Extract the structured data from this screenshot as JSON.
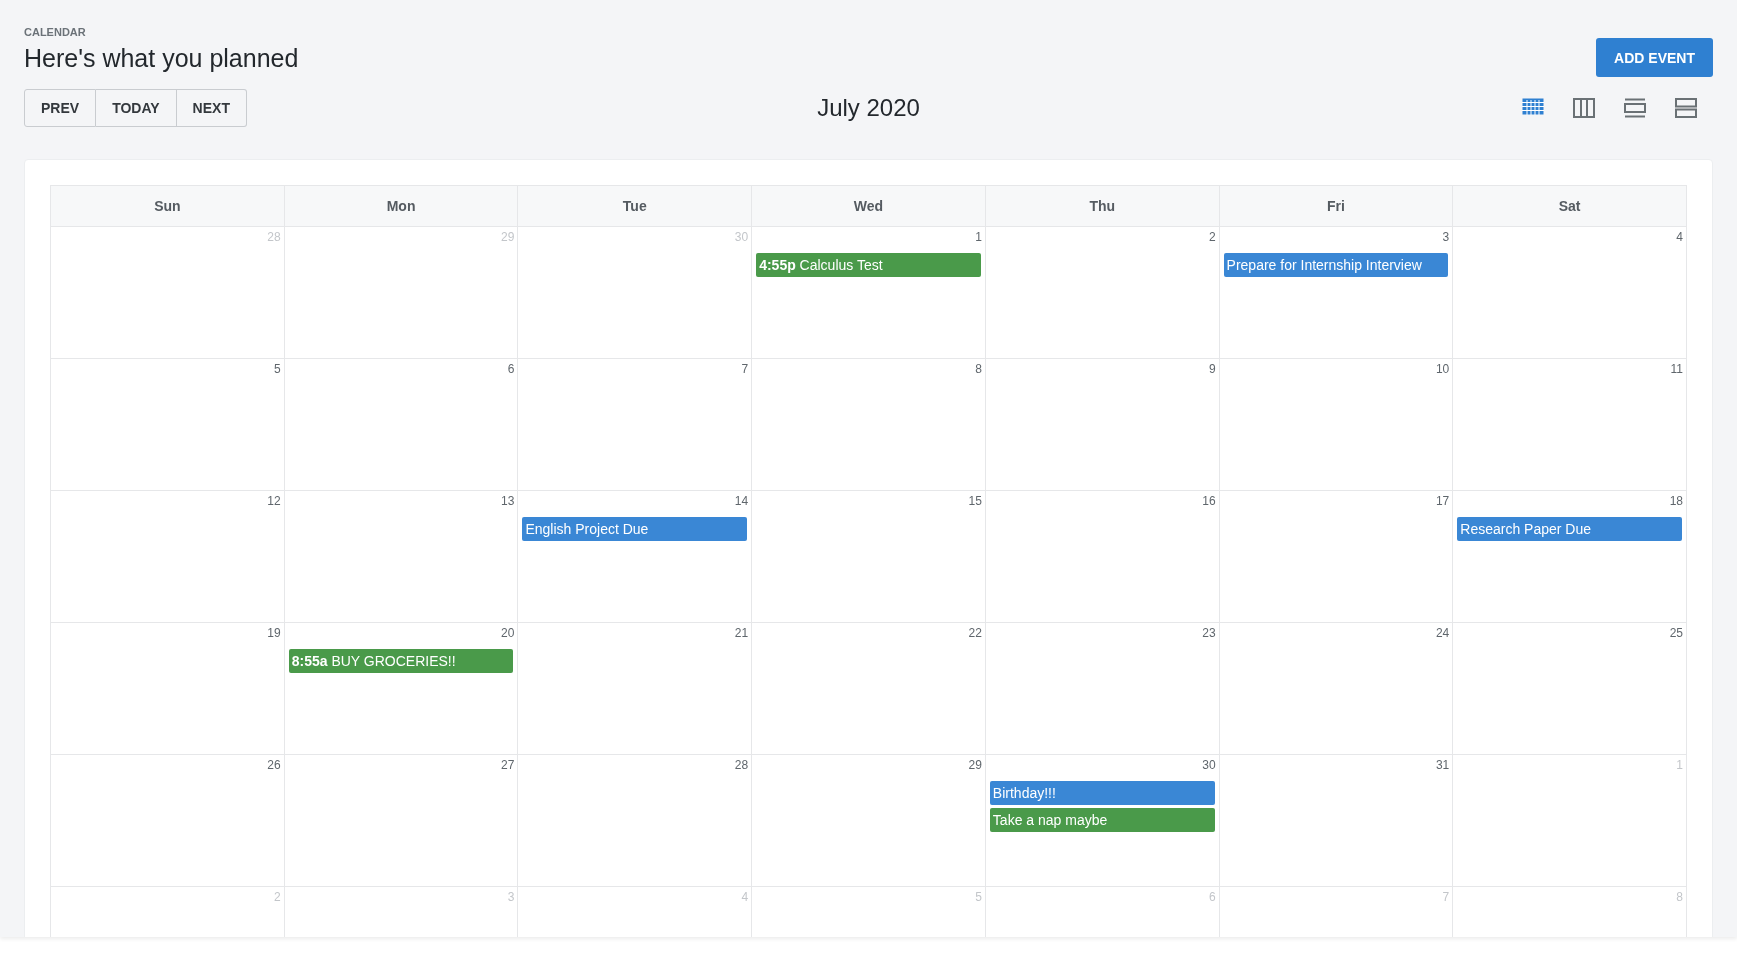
{
  "header": {
    "eyebrow": "CALENDAR",
    "title": "Here's what you planned"
  },
  "nav_buttons": [
    "PREV",
    "TODAY",
    "NEXT"
  ],
  "month_title": "July 2020",
  "add_button": "ADD EVENT",
  "views": [
    {
      "kind": "month",
      "selected": true
    },
    {
      "kind": "week",
      "selected": false
    },
    {
      "kind": "day",
      "selected": false
    },
    {
      "kind": "list",
      "selected": false
    }
  ],
  "weekdays": [
    "Sun",
    "Mon",
    "Tue",
    "Wed",
    "Thu",
    "Fri",
    "Sat"
  ],
  "weeks": [
    [
      {
        "day": "28",
        "other_month": true
      },
      {
        "day": "29",
        "other_month": true
      },
      {
        "day": "30",
        "other_month": true
      },
      {
        "day": "1",
        "other_month": false,
        "events": [
          {
            "time": "4:55p",
            "title": "Calculus Test",
            "color": "#4a9a4a"
          }
        ]
      },
      {
        "day": "2",
        "other_month": false
      },
      {
        "day": "3",
        "other_month": false,
        "events": [
          {
            "title": "Prepare for Internship Interview",
            "color": "#3a87d5"
          }
        ]
      },
      {
        "day": "4",
        "other_month": false
      }
    ],
    [
      {
        "day": "5",
        "other_month": false
      },
      {
        "day": "6",
        "other_month": false
      },
      {
        "day": "7",
        "other_month": false
      },
      {
        "day": "8",
        "other_month": false
      },
      {
        "day": "9",
        "other_month": false
      },
      {
        "day": "10",
        "other_month": false
      },
      {
        "day": "11",
        "other_month": false
      }
    ],
    [
      {
        "day": "12",
        "other_month": false
      },
      {
        "day": "13",
        "other_month": false
      },
      {
        "day": "14",
        "other_month": false,
        "events": [
          {
            "title": "English Project Due",
            "color": "#3a87d5"
          }
        ]
      },
      {
        "day": "15",
        "other_month": false
      },
      {
        "day": "16",
        "other_month": false
      },
      {
        "day": "17",
        "other_month": false
      },
      {
        "day": "18",
        "other_month": false,
        "events": [
          {
            "title": "Research Paper Due",
            "color": "#3a87d5"
          }
        ]
      }
    ],
    [
      {
        "day": "19",
        "other_month": false
      },
      {
        "day": "20",
        "other_month": false,
        "events": [
          {
            "time": "8:55a",
            "title": "BUY GROCERIES!!",
            "color": "#4a9a4a"
          }
        ]
      },
      {
        "day": "21",
        "other_month": false
      },
      {
        "day": "22",
        "other_month": false
      },
      {
        "day": "23",
        "other_month": false
      },
      {
        "day": "24",
        "other_month": false
      },
      {
        "day": "25",
        "other_month": false
      }
    ],
    [
      {
        "day": "26",
        "other_month": false
      },
      {
        "day": "27",
        "other_month": false
      },
      {
        "day": "28",
        "other_month": false
      },
      {
        "day": "29",
        "other_month": false
      },
      {
        "day": "30",
        "other_month": false,
        "events": [
          {
            "title": "Birthday!!!",
            "color": "#3a87d5"
          },
          {
            "title": "Take a nap maybe",
            "color": "#4a9a4a"
          }
        ]
      },
      {
        "day": "31",
        "other_month": false
      },
      {
        "day": "1",
        "other_month": true
      }
    ],
    [
      {
        "day": "2",
        "other_month": true
      },
      {
        "day": "3",
        "other_month": true
      },
      {
        "day": "4",
        "other_month": true
      },
      {
        "day": "5",
        "other_month": true
      },
      {
        "day": "6",
        "other_month": true
      },
      {
        "day": "7",
        "other_month": true
      },
      {
        "day": "8",
        "other_month": true
      }
    ]
  ]
}
